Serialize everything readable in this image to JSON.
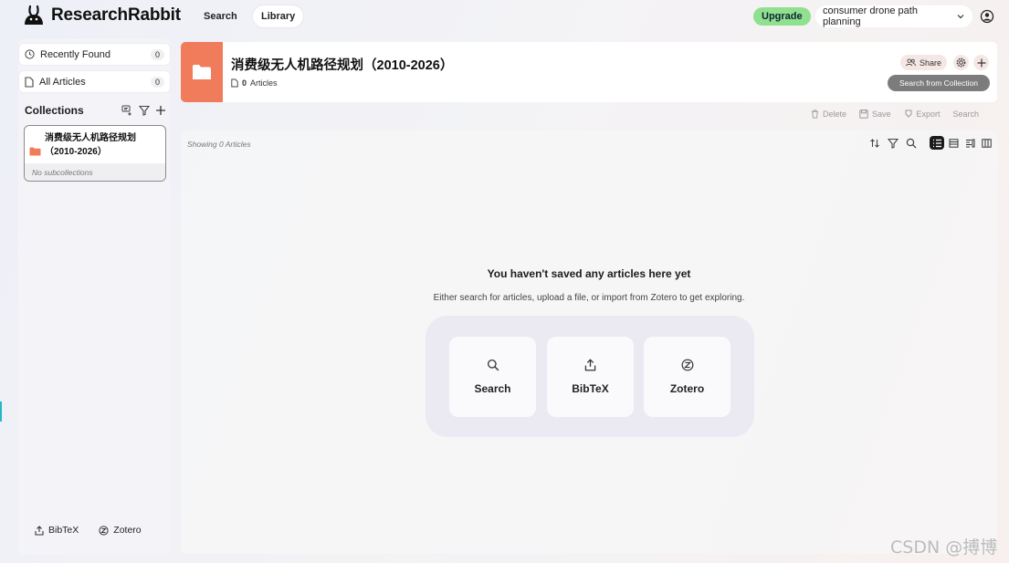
{
  "app": {
    "name": "ResearchRabbit",
    "nav": {
      "search": "Search",
      "library": "Library"
    },
    "upgrade": "Upgrade",
    "project": "consumer drone path planning"
  },
  "sidebar": {
    "recently_found": {
      "label": "Recently Found",
      "count": "0"
    },
    "all_articles": {
      "label": "All Articles",
      "count": "0"
    },
    "collections_title": "Collections",
    "collection": {
      "name_line1": "消费级无人机路径规划",
      "name_line2": "（2010-2026）",
      "subcollections": "No subcollections"
    },
    "footer": {
      "bibtex": "BibTeX",
      "zotero": "Zotero"
    }
  },
  "header": {
    "title": "消费级无人机路径规划（2010-2026）",
    "article_count": "0",
    "article_word": "Articles",
    "share": "Share",
    "search_from_collection": "Search from Collection"
  },
  "actions": {
    "delete": "Delete",
    "save": "Save",
    "export": "Export",
    "search": "Search"
  },
  "main": {
    "showing": "Showing 0 Articles",
    "empty_title": "You haven't saved any articles here yet",
    "empty_sub": "Either search for articles, upload a file, or import from Zotero to get exploring.",
    "options": {
      "search": "Search",
      "bibtex": "BibTeX",
      "zotero": "Zotero"
    }
  },
  "watermark": "CSDN @搏博",
  "colors": {
    "accent_orange": "#f07c5c",
    "upgrade_green": "#8fe08f",
    "search_collection_btn": "#7c7c7c"
  }
}
